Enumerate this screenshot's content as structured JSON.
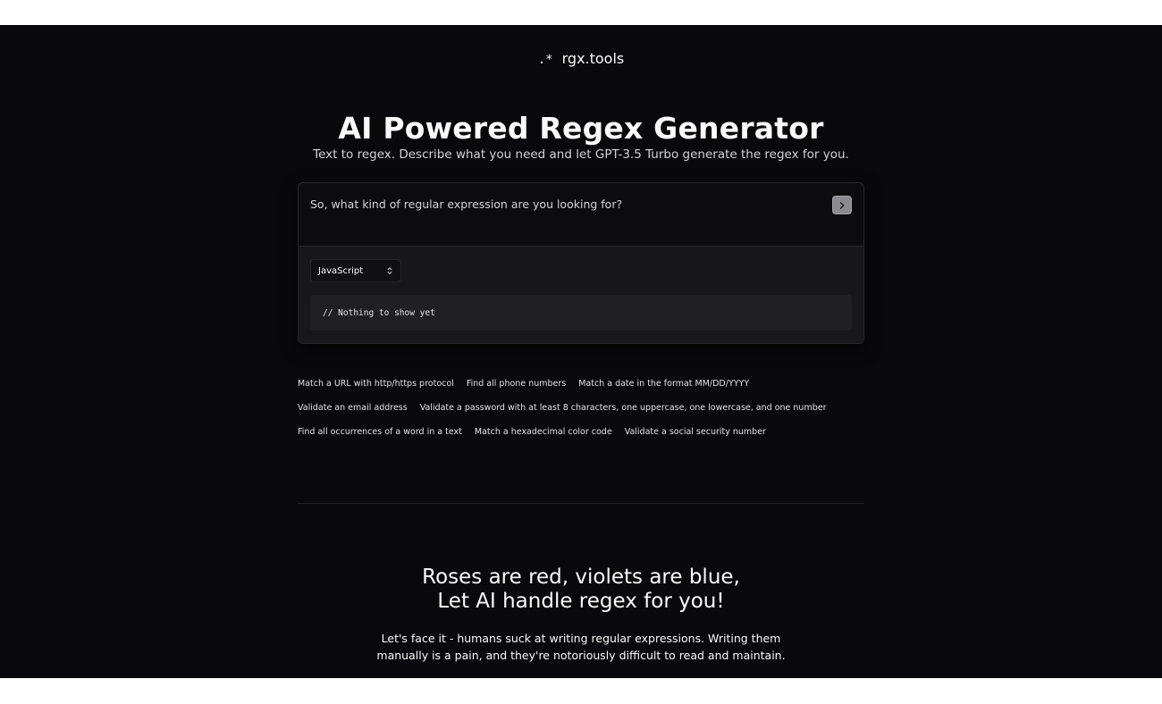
{
  "brand": {
    "icon": ".*",
    "name": "rgx.tools"
  },
  "hero": {
    "title": "AI Powered Regex Generator",
    "subtitle": "Text to regex. Describe what you need and let GPT-3.5 Turbo generate the regex for you."
  },
  "generator": {
    "prompt_placeholder": "So, what kind of regular expression are you looking for?",
    "prompt_value": "",
    "submit_icon": "chevron-right-icon",
    "language_selected": "JavaScript",
    "output": "// Nothing to show yet"
  },
  "examples": [
    [
      "Match a URL with http/https protocol",
      "Find all phone numbers",
      "Match a date in the format MM/DD/YYYY"
    ],
    [
      "Validate an email address",
      "Validate a password with at least 8 characters, one uppercase, one lowercase, and one number"
    ],
    [
      "Find all occurrences of a word in a text",
      "Match a hexadecimal color code",
      "Validate a social security number"
    ]
  ],
  "about": {
    "poem_line1": "Roses are red, violets are blue,",
    "poem_line2": "Let AI handle regex for you!",
    "blurb_line1": "Let's face it - humans suck at writing regular expressions. Writing them",
    "blurb_line2": "manually is a pain, and they're notoriously difficult to read and maintain."
  },
  "colors": {
    "background": "#09090b",
    "card_border": "#27272a",
    "text": "#fafafa",
    "muted_text": "#d4d4d8"
  }
}
